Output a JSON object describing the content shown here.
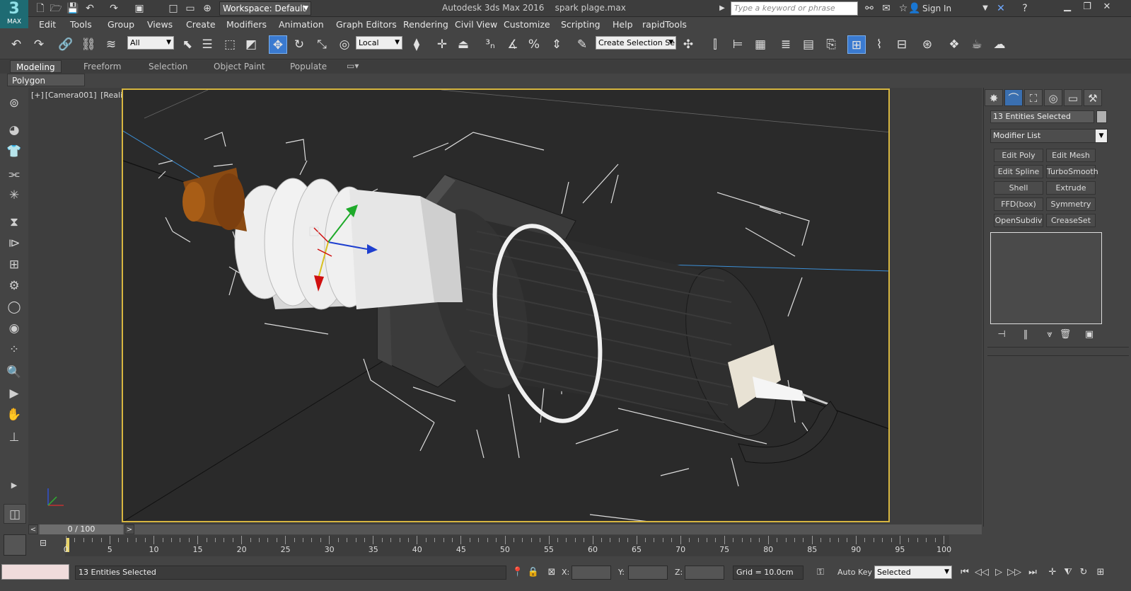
{
  "app": {
    "logo_label": "MAX",
    "title": "Autodesk 3ds Max 2016",
    "filename": "spark plage.max",
    "workspace": "Workspace: Default",
    "search_placeholder": "Type a keyword or phrase",
    "sign_in": "Sign In"
  },
  "menu": [
    "Edit",
    "Tools",
    "Group",
    "Views",
    "Create",
    "Modifiers",
    "Animation",
    "Graph Editors",
    "Rendering",
    "Civil View",
    "Customize",
    "Scripting",
    "Help",
    "rapidTools"
  ],
  "toolbar": {
    "filter": "All",
    "coord_system": "Local",
    "selection_set": "Create Selection Se"
  },
  "ribbon": {
    "tabs": [
      "Modeling",
      "Freeform",
      "Selection",
      "Object Paint",
      "Populate"
    ],
    "active_tab": "Modeling",
    "panel_label": "Polygon Modeling"
  },
  "viewport": {
    "plus": "[+]",
    "camera": "[Camera001]",
    "shading": "[Realistic]"
  },
  "command_panel": {
    "selection_name": "13 Entities Selected",
    "modifier_list": "Modifier List",
    "modifier_buttons": [
      "Edit Poly",
      "Edit Mesh",
      "Edit Spline",
      "TurboSmooth",
      "Shell",
      "Extrude",
      "FFD(box)",
      "Symmetry",
      "OpenSubdiv",
      "CreaseSet"
    ]
  },
  "timeline": {
    "frame_display": "0 / 100",
    "ticks": [
      "0",
      "5",
      "10",
      "15",
      "20",
      "25",
      "30",
      "35",
      "40",
      "45",
      "50",
      "55",
      "60",
      "65",
      "70",
      "75",
      "80",
      "85",
      "90",
      "95",
      "100"
    ]
  },
  "status": {
    "selection": "13 Entities Selected",
    "x_label": "X:",
    "y_label": "Y:",
    "z_label": "Z:",
    "grid": "Grid = 10.0cm",
    "auto_key": "Auto Key",
    "set_key_mode": "Selected"
  },
  "colors": {
    "viewport_border": "#d7b640",
    "viewport_bg": "#2a2a2a",
    "ui_bg": "#444444",
    "active_blue": "#3a7ad0"
  }
}
